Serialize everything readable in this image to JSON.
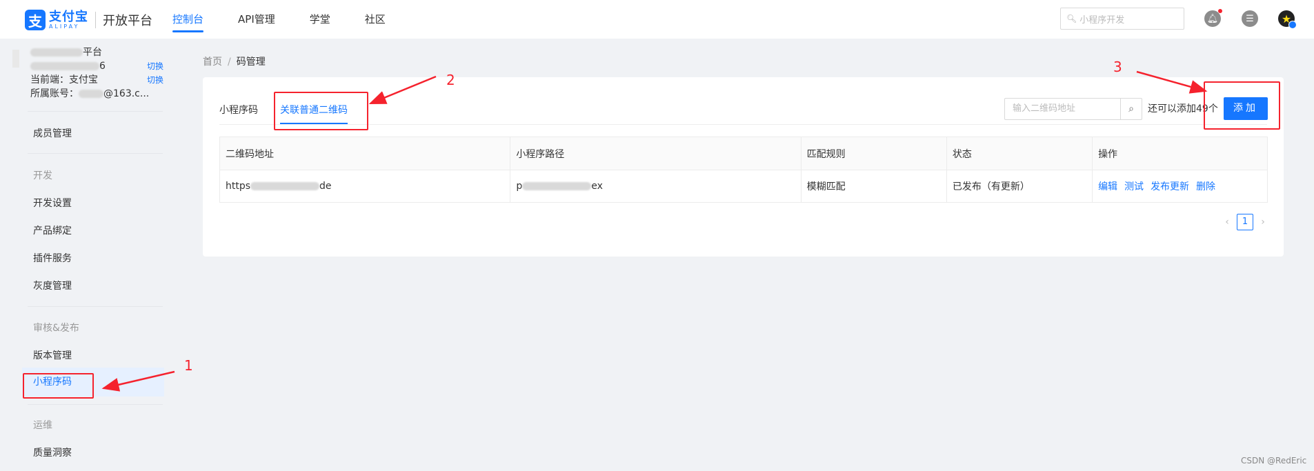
{
  "header": {
    "logo_cn": "支付宝",
    "logo_en": "ALIPAY",
    "platform": "开放平台",
    "nav": [
      "控制台",
      "API管理",
      "学堂",
      "社区"
    ],
    "active_nav": "控制台",
    "search_placeholder": "小程序开发"
  },
  "sidebar": {
    "account": {
      "name_suffix": "平台",
      "id_suffix": "6",
      "switch_label": "切换",
      "current_end_label": "当前端：支付宝",
      "owner_label": "所属账号：",
      "owner_suffix": "@163.c..."
    },
    "items": {
      "members": "成员管理",
      "group_dev": "开发",
      "dev_settings": "开发设置",
      "product_binding": "产品绑定",
      "plugin_service": "插件服务",
      "gray_management": "灰度管理",
      "group_review": "审核&发布",
      "version_management": "版本管理",
      "mini_code": "小程序码",
      "group_ops": "运维",
      "quality_insight": "质量洞察"
    }
  },
  "breadcrumb": {
    "home": "首页",
    "separator": "/",
    "current": "码管理"
  },
  "card": {
    "tabs": [
      "小程序码",
      "关联普通二维码"
    ],
    "active_tab": "关联普通二维码",
    "qr_input_placeholder": "输入二维码地址",
    "remaining_text": "还可以添加49个",
    "add_button": "添加",
    "table": {
      "headers": [
        "二维码地址",
        "小程序路径",
        "匹配规则",
        "状态",
        "操作"
      ],
      "rows": [
        {
          "qr_prefix": "https",
          "qr_suffix": "de",
          "path_prefix": "p",
          "path_suffix": "ex",
          "match_rule": "模糊匹配",
          "status": "已发布（有更新）",
          "ops": [
            "编辑",
            "测试",
            "发布更新",
            "删除"
          ]
        }
      ]
    },
    "pagination": {
      "current_page": "1"
    }
  },
  "annotations": {
    "labels": [
      "1",
      "2",
      "3"
    ],
    "color": "#f5222d"
  },
  "watermark": "CSDN @RedEric",
  "colors": {
    "primary": "#1677ff",
    "annotation": "#f5222d"
  }
}
